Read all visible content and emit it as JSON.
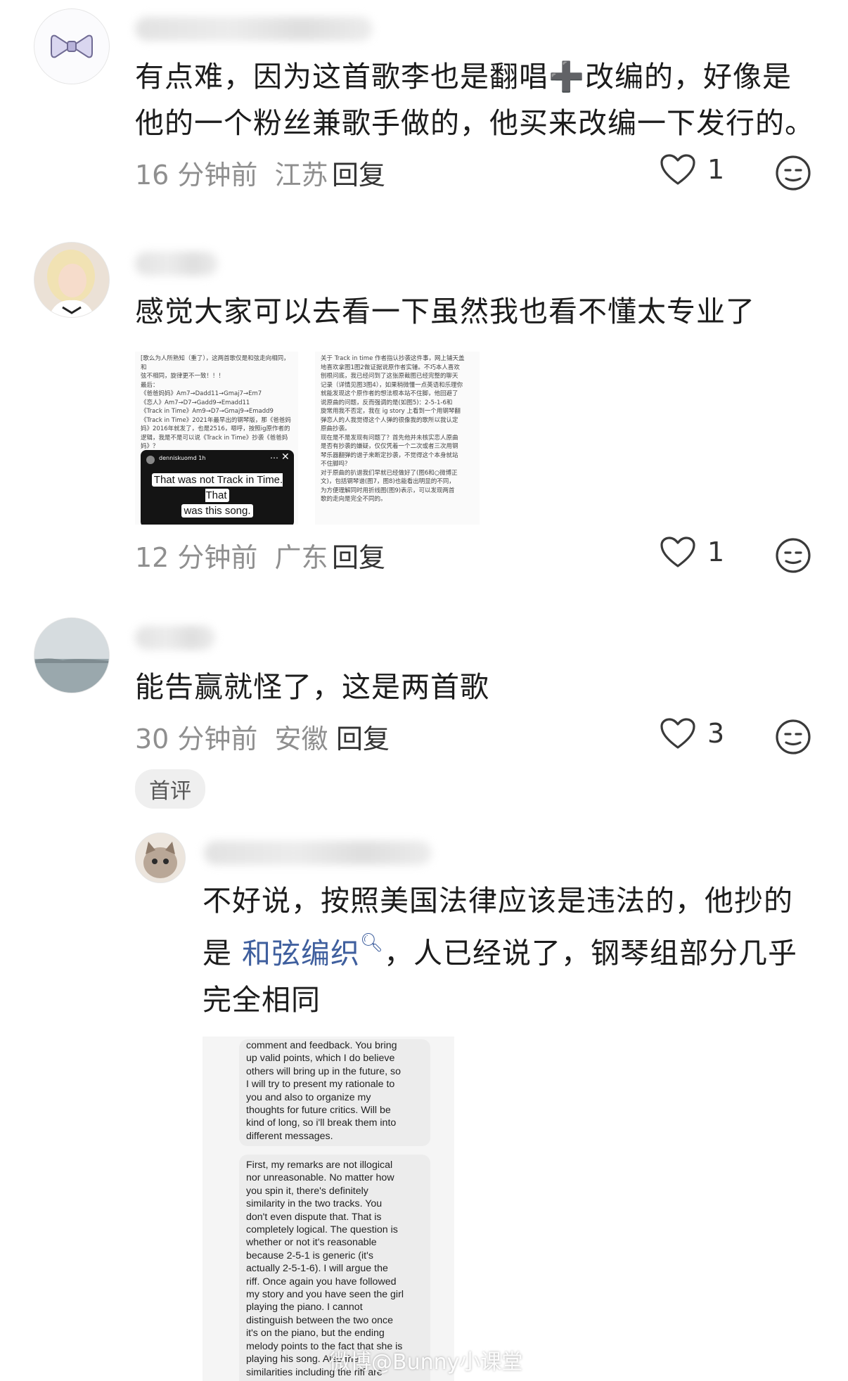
{
  "comments": [
    {
      "text_line1": "有点难，因为这首歌李也是翻唱➕改编的，好像是",
      "text_line2": "他的一个粉丝兼歌手做的，他买来改编一下发行的。",
      "time": "16 分钟前",
      "location": "江苏",
      "reply_label": "回复",
      "likes": "1"
    },
    {
      "text_line1": "感觉大家可以去看一下虽然我也看不懂太专业了",
      "time": "12 分钟前",
      "location": "广东",
      "reply_label": "回复",
      "likes": "1",
      "attachments": {
        "image1_text": "[歌么为人所熟知（重了），这两首歌仅是和弦走向相同，和\n弦不相同，旋律更不一致！！！\n最后：\n《爸爸妈妈》Am7→Dadd11→Gmaj7→Em7\n《恋人》Am7→D7→Gadd9→Emadd11\n《Track in Time》Am9→D7→Gmaj9→Emadd9\n《Track in Time》2021年最早出的钢琴版，那《爸爸妈\n妈》2016年就发了，也是2516，嗯呼，按照ig原作者的\n逻辑，我是不是可以说《Track in Time》抄袭《爸爸妈\n妈》？",
        "story_user": "denniskuomd  1h",
        "story_caption_1": "That was not Track in Time. That",
        "story_caption_2": "was this song.",
        "image2_text": "关于 Track in time 作者指认抄袭这件事，网上铺天盖\n地喜欢拿图1图2做证据说原作者实锤。不巧本人喜欢\n刨根问底，我已经问到了这张原截图已经完整的聊天\n记录（详情见图3图4），如果稍微懂一点英语和乐理你\n就能发现这个原作者的想法根本站不住脚，他回避了\n说原曲的问题，反而强调的是(如图5)：2-5-1-6和\n旋常用我不否定，我在 ig story 上看到一个用钢琴翻\n弹恋人的人我觉得这个人弹的很像我的歌所以我认定\n原曲抄袭。\n现在是不是发现有问题了？首先他并未核实恋人原曲\n是否有抄袭的嫌疑，仅仅凭着一个二次或者三次用钢\n琴乐器翻弹的谱子来断定抄袭，不觉得这个本身就站\n不住脚吗？\n对于原曲的扒谱我们早就已经做好了(图6和○微博正\n文)，包括钢琴谱(图7，图8)也能看出明显的不同，\n为方便理解同时用折线图(图9)表示，可以发现两首\n歌的走向是完全不同的。"
      }
    },
    {
      "text_line1": "能告赢就怪了，这是两首歌",
      "time": "30 分钟前",
      "location": "安徽",
      "reply_label": "回复",
      "likes": "3",
      "badge": "首评"
    }
  ],
  "reply": {
    "text_line1": "不好说，按照美国法律应该是违法的，他抄的",
    "text_line2_pre": "是 ",
    "link_text": "和弦编织",
    "link_icon": "search-icon",
    "text_line2_post": "，人已经说了，钢琴组部分几乎",
    "text_line3": "完全相同",
    "message_1": "comment and feedback. You bring\nup valid points, which I do believe\nothers will bring up in the future, so\nI will try to present my rationale to\nyou and also to organize my\nthoughts for future critics. Will be\nkind of long, so i'll break them into\ndifferent messages.",
    "message_2": "First, my remarks are not illogical\nnor unreasonable. No matter how\nyou spin it, there's definitely\nsimilarity in the two tracks. You\ndon't even dispute that. That is\ncompletely logical. The question is\nwhether or not it's reasonable\nbecause 2-5-1 is generic (it's\nactually 2-5-1-6). I will argue the\nriff. Once again you have followed\nmy story and you have seen the girl\nplaying the piano. I cannot\ndistinguish between the two once\nit's on the piano, but the ending\nmelody points to the fact that she is\nplaying his song. Also the\nsimilarities including the riff are"
  },
  "watermark": "微博@Bunny小课堂",
  "colors": {
    "meta_gray": "#8f8f8f",
    "link_blue": "#3f5f9e",
    "badge_bg": "#efefef"
  }
}
